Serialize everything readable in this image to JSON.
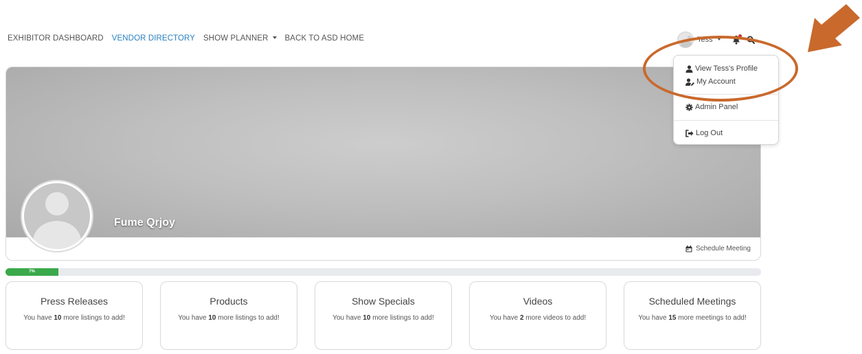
{
  "nav": {
    "items": [
      {
        "label": "EXHIBITOR DASHBOARD",
        "active": false,
        "dropdown": false
      },
      {
        "label": "VENDOR DIRECTORY",
        "active": true,
        "dropdown": false
      },
      {
        "label": "SHOW PLANNER",
        "active": false,
        "dropdown": true
      },
      {
        "label": "BACK TO ASD HOME",
        "active": false,
        "dropdown": false
      }
    ],
    "user_name": "Tess",
    "icons": {
      "bell": "bell-icon",
      "search": "search-icon"
    },
    "colors": {
      "active_link": "#2a7fbf",
      "notification_dot": "#d32f2f"
    }
  },
  "user_menu": {
    "items": [
      {
        "label": "View Tess's Profile",
        "icon": "user-icon"
      },
      {
        "label": "My Account",
        "icon": "user-edit-icon"
      },
      {
        "label": "Admin Panel",
        "icon": "gear-icon"
      },
      {
        "label": "Log Out",
        "icon": "logout-icon"
      }
    ]
  },
  "annotation": {
    "color": "#c9692c"
  },
  "profile": {
    "company_name": "Fume Qrjoy",
    "schedule_label": "Schedule Meeting"
  },
  "progress": {
    "percent": 7,
    "label": "7%",
    "color": "#3aa94a"
  },
  "cards": [
    {
      "title": "Press Releases",
      "pre": "You have ",
      "count": "10",
      "post": " more listings to add!"
    },
    {
      "title": "Products",
      "pre": "You have ",
      "count": "10",
      "post": " more listings to add!"
    },
    {
      "title": "Show Specials",
      "pre": "You have ",
      "count": "10",
      "post": " more listings to add!"
    },
    {
      "title": "Videos",
      "pre": "You have ",
      "count": "2",
      "post": " more videos to add!"
    },
    {
      "title": "Scheduled Meetings",
      "pre": "You have ",
      "count": "15",
      "post": " more meetings to add!"
    }
  ]
}
